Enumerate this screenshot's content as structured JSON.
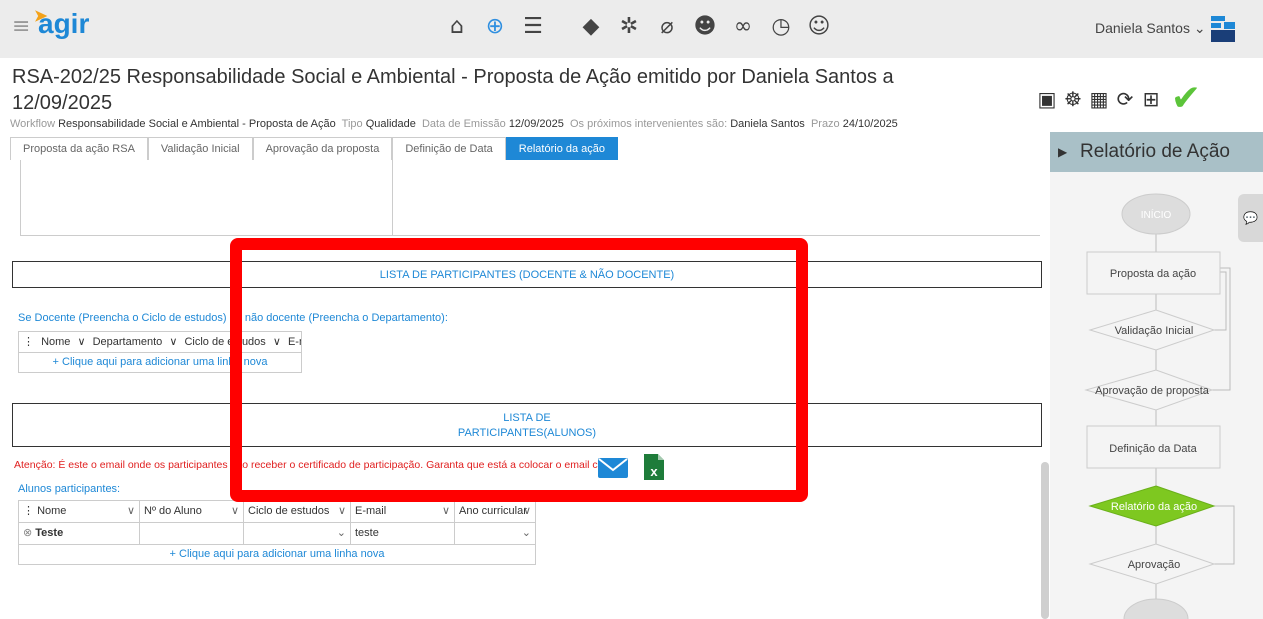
{
  "app": {
    "logo": "agir",
    "user_name": "Daniela Santos"
  },
  "nav_icons": [
    "home-icon",
    "add-icon",
    "list-icon",
    "tags-icon",
    "settings-icon",
    "attachment-icon",
    "users-icon",
    "link-icon",
    "clock-icon",
    "user-admin-icon"
  ],
  "page": {
    "title": "RSA-202/25 Responsabilidade Social e Ambiental - Proposta de Ação emitido por Daniela Santos a 12/09/2025",
    "meta": {
      "workflow_label": "Workflow",
      "workflow_value": "Responsabilidade Social e Ambiental - Proposta de Ação",
      "tipo_label": "Tipo",
      "tipo_value": "Qualidade",
      "emissao_label": "Data de Emissão",
      "emissao_value": "12/09/2025",
      "intervenientes_label": "Os próximos intervenientes são:",
      "intervenientes_value": "Daniela Santos",
      "prazo_label": "Prazo",
      "prazo_value": "24/10/2025"
    }
  },
  "tabs": [
    "Proposta da ação RSA",
    "Validação Inicial",
    "Aprovação da proposta",
    "Definição de Data",
    "Relatório da ação"
  ],
  "form": {
    "section1_title": "LISTA DE PARTICIPANTES (DOCENTE & NÃO DOCENTE)",
    "section1_note": "Se Docente (Preencha o Ciclo de estudos) ou não docente (Preencha o Departamento):",
    "table1_columns": [
      "Nome",
      "Departamento",
      "Ciclo de estudos",
      "E-mail"
    ],
    "add_row": "+ Clique aqui para adicionar uma linha nova",
    "section2_title_line1": "LISTA DE",
    "section2_title_line2": "PARTICIPANTES(ALUNOS)",
    "warning": "Atenção: É este o email onde os participantes irão receber o certificado de participação. Garanta que está a colocar o email correto!",
    "alunos_label": "Alunos participantes:",
    "table2_columns": [
      "Nome",
      "Nº do Aluno",
      "Ciclo de estudos",
      "E-mail",
      "Ano curricular"
    ],
    "table2_rows": [
      {
        "nome": "Teste",
        "numero": "",
        "ciclo": "",
        "email": "teste",
        "ano": ""
      }
    ]
  },
  "sidebar": {
    "title": "Relatório de Ação",
    "flow": [
      "INÍCIO",
      "Proposta da ação",
      "Validação Inicial",
      "Aprovação de proposta",
      "Definição da Data",
      "Relatório da ação",
      "Aprovação"
    ]
  },
  "colors": {
    "accent": "#1e88d6",
    "active_node": "#7ec820",
    "highlight": "#ff0000",
    "check": "#5cc43a"
  }
}
